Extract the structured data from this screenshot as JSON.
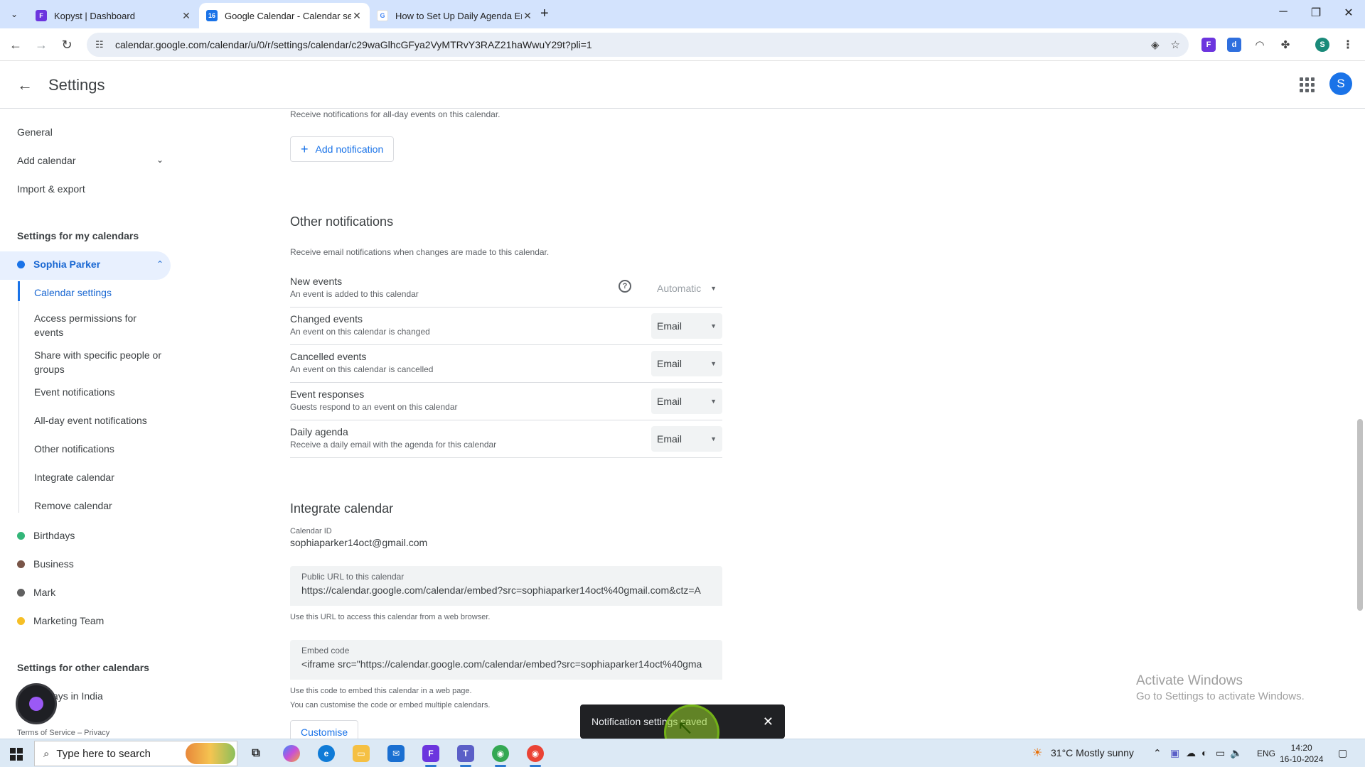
{
  "browser": {
    "tabs": [
      {
        "title": "Kopyst | Dashboard",
        "favicon": "kopyst-icon",
        "color": "#6c35de"
      },
      {
        "title": "Google Calendar - Calendar set",
        "favicon": "google-calendar-icon",
        "color": "#1a73e8"
      },
      {
        "title": "How to Set Up Daily Agenda En",
        "favicon": "google-icon",
        "color": "#4285f4"
      }
    ],
    "url": "calendar.google.com/calendar/u/0/r/settings/calendar/c29waGlhcGFya2VyMTRvY3RAZ21haWwuY29t?pli=1",
    "profile_initial": "S"
  },
  "app": {
    "title": "Settings",
    "avatar_initial": "S"
  },
  "sidebar": {
    "general": "General",
    "add_calendar": "Add calendar",
    "import_export": "Import & export",
    "my_calendars_heading": "Settings for my calendars",
    "active_calendar": "Sophia Parker",
    "sub_items": [
      "Calendar settings",
      "Access permissions for events",
      "Share with specific people or groups",
      "Event notifications",
      "All-day event notifications",
      "Other notifications",
      "Integrate calendar",
      "Remove calendar"
    ],
    "calendars": [
      {
        "name": "Birthdays",
        "color": "#33b679"
      },
      {
        "name": "Business",
        "color": "#795548"
      },
      {
        "name": "Mark",
        "color": "#616161"
      },
      {
        "name": "Marketing Team",
        "color": "#f6bf26"
      }
    ],
    "other_calendars_heading": "Settings for other calendars",
    "other_calendar": "ays in India",
    "footer": "Terms of Service – Privacy"
  },
  "main": {
    "allday_desc": "Receive notifications for all-day events on this calendar.",
    "add_notification": "Add notification",
    "other_notifications": {
      "title": "Other notifications",
      "desc": "Receive email notifications when changes are made to this calendar.",
      "rows": [
        {
          "title": "New events",
          "sub": "An event is added to this calendar",
          "value": "Automatic",
          "disabled": true
        },
        {
          "title": "Changed events",
          "sub": "An event on this calendar is changed",
          "value": "Email"
        },
        {
          "title": "Cancelled events",
          "sub": "An event on this calendar is cancelled",
          "value": "Email"
        },
        {
          "title": "Event responses",
          "sub": "Guests respond to an event on this calendar",
          "value": "Email"
        },
        {
          "title": "Daily agenda",
          "sub": "Receive a daily email with the agenda for this calendar",
          "value": "Email"
        }
      ]
    },
    "integrate": {
      "title": "Integrate calendar",
      "calendar_id_label": "Calendar ID",
      "calendar_id": "sophiaparker14oct@gmail.com",
      "public_url_label": "Public URL to this calendar",
      "public_url": "https://calendar.google.com/calendar/embed?src=sophiaparker14oct%40gmail.com&ctz=A",
      "public_url_help": "Use this URL to access this calendar from a web browser.",
      "embed_label": "Embed code",
      "embed_code": "<iframe src=\"https://calendar.google.com/calendar/embed?src=sophiaparker14oct%40gma",
      "embed_help_1": "Use this code to embed this calendar in a web page.",
      "embed_help_2": "You can customise the code or embed multiple calendars.",
      "customise": "Customise"
    }
  },
  "snackbar": {
    "message": "Notification settings saved"
  },
  "watermark": {
    "line1": "Activate Windows",
    "line2": "Go to Settings to activate Windows."
  },
  "taskbar": {
    "search_placeholder": "Type here to search",
    "weather": "31°C  Mostly sunny",
    "lang": "ENG",
    "time": "14:20",
    "date": "16-10-2024"
  }
}
